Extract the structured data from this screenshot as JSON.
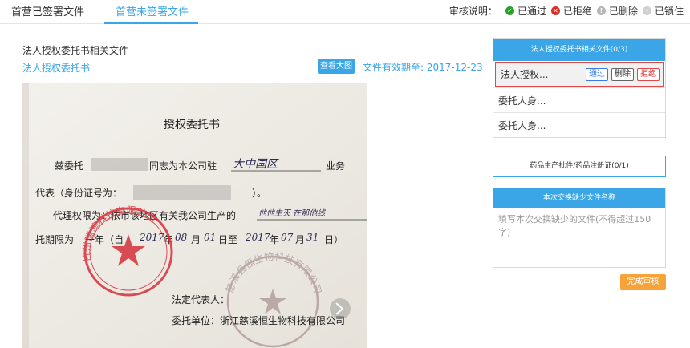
{
  "tabs": [
    {
      "label": "首营已签署文件"
    },
    {
      "label": "首营未签署文件"
    }
  ],
  "legend": {
    "title": "审核说明：",
    "items": [
      {
        "label": "已通过",
        "icon": "check-circle-icon",
        "color": "#2aa02a"
      },
      {
        "label": "已拒绝",
        "icon": "x-circle-icon",
        "color": "#d9302a"
      },
      {
        "label": "已删除",
        "icon": "info-circle-icon",
        "color": "#b5b5b5"
      },
      {
        "label": "已锁住",
        "icon": "lock-circle-icon",
        "color": "#d0d0d0"
      }
    ]
  },
  "section": {
    "title": "法人授权委托书相关文件",
    "doc_link": "法人授权委托书",
    "view_button": "查看大图",
    "valid_until": "文件有效期至: 2017-12-23"
  },
  "document": {
    "heading": "授权委托书",
    "line1_a": "兹委托",
    "line1_b": "同志为本公司驻",
    "line1_hand": "大中国区",
    "line1_c": "业务",
    "line2": "代表（身份证号为：",
    "line2_end": "）。",
    "line3_a": "代理权限为：依市该地区有关我公司生产的",
    "line3_hand": "他他生灭 在那他线",
    "line4_a": "托期限为",
    "line4_b": "一年（自",
    "line4_hand1": "2017",
    "line4_c": "年",
    "line4_hand2": "08",
    "line4_d": "月",
    "line4_hand3": "01",
    "line4_e": "日至",
    "line4_hand4": "2017",
    "line4_f": "年",
    "line4_hand5": "07",
    "line4_g": "月",
    "line4_hand6": "31",
    "line4_h": "日）",
    "legal_rep": "法定代表人：",
    "entrust_unit": "委托单位：浙江慈溪恒生物科技有限公司",
    "stamp_text_1": "杭州瑞鸿科技有限公司",
    "stamp_text_2": "慈溪县恒生物科技有限公司"
  },
  "file_panel": {
    "title": "法人授权委托书相关文件(0/3)",
    "files": [
      {
        "name": "法人授权...",
        "pass": "通过",
        "delete": "删除",
        "reject": "拒绝"
      },
      {
        "name": "委托人身..."
      },
      {
        "name": "委托人身..."
      }
    ]
  },
  "license_panel": {
    "title": "药品生产批件/药品注册证(0/1)"
  },
  "missing_panel": {
    "title": "本次交换缺少文件名称",
    "placeholder": "填写本次交换缺少的文件(不得超过150字)"
  },
  "complete_button": "完成审核"
}
